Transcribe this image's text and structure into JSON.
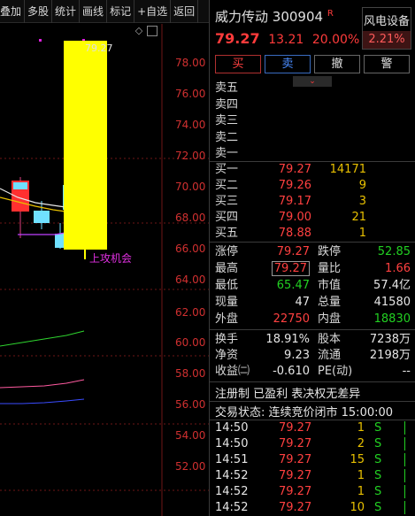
{
  "toolbar": {
    "items": [
      "叠加",
      "多股",
      "统计",
      "画线",
      "标记",
      "+自选",
      "返回"
    ]
  },
  "chart": {
    "y_ticks": [
      "78.00",
      "76.00",
      "74.00",
      "72.00",
      "70.00",
      "68.00",
      "66.00",
      "64.00",
      "62.00",
      "60.00",
      "58.00",
      "56.00",
      "54.00",
      "52.00"
    ],
    "high_label": "79.27",
    "signal_label": "上攻机会",
    "colors": {
      "candle_limit_up": "#ffff00",
      "ma_green": "#2fd52f",
      "ma_pink": "#ff5aa0",
      "ma_blue": "#3a4cff",
      "grid": "#8b1a1a",
      "axis_text": "#d03030"
    }
  },
  "stock": {
    "name": "威力传动",
    "code": "300904",
    "badge": "R",
    "price": "79.27",
    "change": "13.21",
    "change_pct": "20.00%",
    "sector": "风电设备",
    "sector_pct": "2.21%"
  },
  "actions": {
    "buy": "买",
    "sell": "卖",
    "cancel": "撤",
    "alert": "警"
  },
  "asks": [
    {
      "label": "卖五"
    },
    {
      "label": "卖四"
    },
    {
      "label": "卖三"
    },
    {
      "label": "卖二"
    },
    {
      "label": "卖一"
    }
  ],
  "bids": [
    {
      "label": "买一",
      "price": "79.27",
      "vol": "14171"
    },
    {
      "label": "买二",
      "price": "79.26",
      "vol": "9"
    },
    {
      "label": "买三",
      "price": "79.17",
      "vol": "3"
    },
    {
      "label": "买四",
      "price": "79.00",
      "vol": "21"
    },
    {
      "label": "买五",
      "price": "78.88",
      "vol": "1"
    }
  ],
  "stats": {
    "limit_up_label": "涨停",
    "limit_up": "79.27",
    "limit_down_label": "跌停",
    "limit_down": "52.85",
    "high_label": "最高",
    "high": "79.27",
    "vol_ratio_label": "量比",
    "vol_ratio": "1.66",
    "low_label": "最低",
    "low": "65.47",
    "mkt_cap_label": "市值",
    "mkt_cap": "57.4亿",
    "cur_vol_label": "现量",
    "cur_vol": "47",
    "total_vol_label": "总量",
    "total_vol": "41580",
    "outer_label": "外盘",
    "outer": "22750",
    "inner_label": "内盘",
    "inner": "18830",
    "turnover_label": "换手",
    "turnover": "18.91%",
    "share_cap_label": "股本",
    "share_cap": "7238万",
    "nav_label": "净资",
    "nav": "9.23",
    "float_label": "流通",
    "float": "2198万",
    "eps_label": "收益㈡",
    "eps": "-0.610",
    "pe_label": "PE(动)",
    "pe": "--"
  },
  "info": {
    "tags": "注册制 已盈利 表决权无差异",
    "status": "交易状态: 连续竞价闭市 15:00:00"
  },
  "ticks": [
    {
      "time": "14:50",
      "price": "79.27",
      "vol": "1",
      "side": "S"
    },
    {
      "time": "14:50",
      "price": "79.27",
      "vol": "2",
      "side": "S"
    },
    {
      "time": "14:51",
      "price": "79.27",
      "vol": "15",
      "side": "S"
    },
    {
      "time": "14:52",
      "price": "79.27",
      "vol": "1",
      "side": "S"
    },
    {
      "time": "14:52",
      "price": "79.27",
      "vol": "1",
      "side": "S"
    },
    {
      "time": "14:52",
      "price": "79.27",
      "vol": "10",
      "side": "S"
    }
  ]
}
